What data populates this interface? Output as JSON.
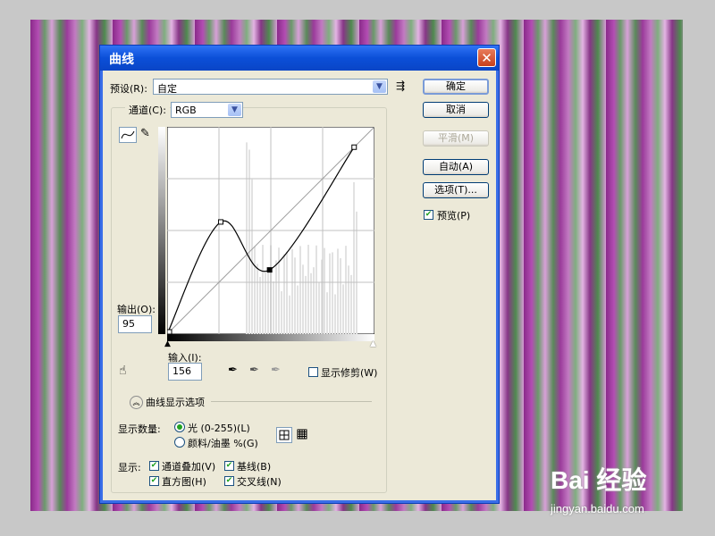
{
  "dialog": {
    "title": "曲线",
    "close_symbol": "✕"
  },
  "preset": {
    "label": "预设(R):",
    "value": "自定",
    "menu_icon": "preset-options-icon"
  },
  "channel": {
    "label": "通道(C):",
    "value": "RGB"
  },
  "buttons": {
    "ok": "确定",
    "cancel": "取消",
    "smooth": "平滑(M)",
    "auto": "自动(A)",
    "options": "选项(T)..."
  },
  "preview": {
    "label": "预览(P)",
    "checked": true
  },
  "output": {
    "label": "输出(O):",
    "value": "95"
  },
  "input": {
    "label": "输入(I):",
    "value": "156"
  },
  "show_clipping": {
    "label": "显示修剪(W)",
    "checked": false
  },
  "curve_display_options": {
    "label": "曲线显示选项"
  },
  "show_amount": {
    "label": "显示数量:",
    "light": "光 (0-255)(L)",
    "pigment": "颜料/油墨 %(G)",
    "selected": "light"
  },
  "show": {
    "label": "显示:",
    "channel_overlays": "通道叠加(V)",
    "baseline": "基线(B)",
    "histogram": "直方图(H)",
    "intersection_line": "交叉线(N)"
  },
  "curve": {
    "control_points": [
      [
        0,
        0
      ],
      [
        66,
        138
      ],
      [
        126,
        79
      ],
      [
        230,
        230
      ]
    ],
    "input_value": 156,
    "output_value": 95
  },
  "icons": {
    "curve_tool": "curve-edit-icon",
    "pencil_tool": "pencil-icon",
    "hand_tool": "on-image-adjust-icon",
    "eyedropper_black": "black-eyedropper-icon",
    "eyedropper_gray": "gray-eyedropper-icon",
    "eyedropper_white": "white-eyedropper-icon",
    "grid_simple": "simple-grid-icon",
    "grid_detailed": "detailed-grid-icon"
  },
  "watermark": {
    "brand": "Bai 经验",
    "url": "jingyan.baidu.com"
  }
}
